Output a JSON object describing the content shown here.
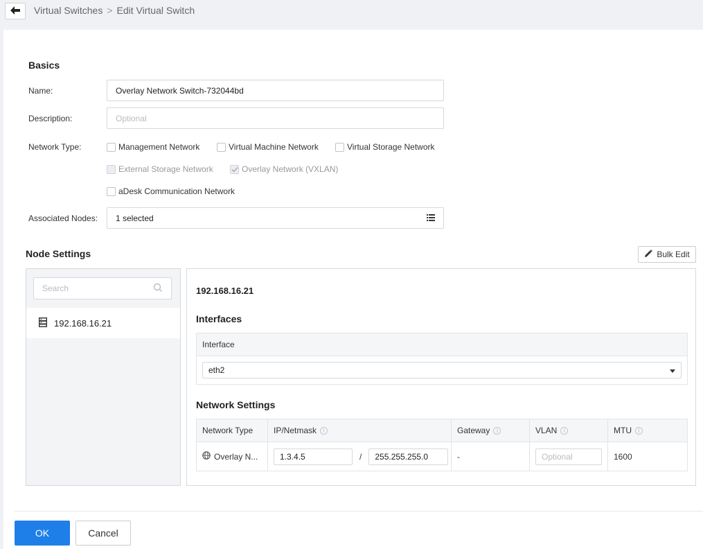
{
  "breadcrumb": {
    "parent": "Virtual Switches",
    "separator": ">",
    "current": "Edit Virtual Switch"
  },
  "basics": {
    "title": "Basics",
    "name_label": "Name:",
    "name_value": "Overlay Network Switch-732044bd",
    "description_label": "Description:",
    "description_placeholder": "Optional",
    "network_type_label": "Network Type:",
    "network_types": [
      {
        "label": "Management Network",
        "checked": false,
        "disabled": false
      },
      {
        "label": "Virtual Machine Network",
        "checked": false,
        "disabled": false
      },
      {
        "label": "Virtual Storage Network",
        "checked": false,
        "disabled": false
      },
      {
        "label": "External Storage Network",
        "checked": false,
        "disabled": true
      },
      {
        "label": "Overlay Network (VXLAN)",
        "checked": true,
        "disabled": true
      },
      {
        "label": "aDesk Communication Network",
        "checked": false,
        "disabled": false
      }
    ],
    "associated_nodes_label": "Associated Nodes:",
    "associated_nodes_value": "1 selected"
  },
  "node_settings": {
    "title": "Node Settings",
    "bulk_edit_label": "Bulk Edit",
    "search_placeholder": "Search",
    "nodes": [
      {
        "ip": "192.168.16.21"
      }
    ],
    "detail": {
      "node_ip": "192.168.16.21",
      "interfaces_title": "Interfaces",
      "interface_header": "Interface",
      "interface_value": "eth2",
      "network_settings_title": "Network Settings",
      "columns": [
        "Network Type",
        "IP/Netmask",
        "Gateway",
        "VLAN",
        "MTU"
      ],
      "row": {
        "network_type": "Overlay N...",
        "ip": "1.3.4.5",
        "slash": "/",
        "netmask": "255.255.255.0",
        "gateway": "-",
        "vlan_placeholder": "Optional",
        "mtu": "1600"
      }
    }
  },
  "footer": {
    "ok_label": "OK",
    "cancel_label": "Cancel"
  },
  "colors": {
    "primary": "#1e7fe8",
    "page_bg": "#f0f1f4",
    "border": "#d5d8de"
  }
}
